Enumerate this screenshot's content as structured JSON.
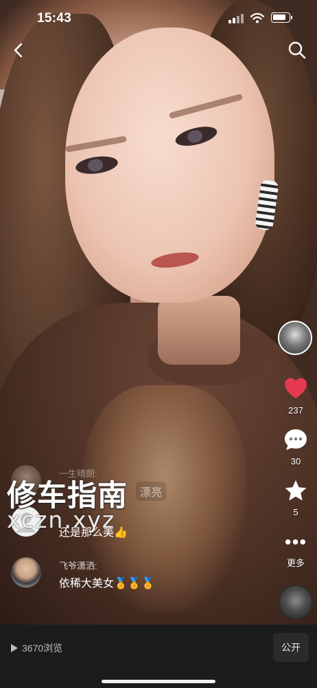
{
  "status_bar": {
    "time": "15:43"
  },
  "icons": {
    "back": "chevron-left-icon",
    "search": "search-icon",
    "like": "heart-icon",
    "comment": "chat-bubble-icon",
    "favorite": "star-icon",
    "more": "ellipsis-icon"
  },
  "colors": {
    "like": "#e53950",
    "background": "#1c1c1c"
  },
  "actions": {
    "likes": "237",
    "comments": "30",
    "stars": "5",
    "more_label": "更多"
  },
  "comments": [
    {
      "name": "一生晴朗:",
      "text": "漂亮"
    },
    {
      "name": "",
      "text": "还是那么美👍"
    },
    {
      "name": "飞爷潇洒:",
      "text": "依稀大美女🏅🏅🏅"
    }
  ],
  "watermark": {
    "main": "修车指南",
    "sub": "xczn.xyz"
  },
  "footer": {
    "views": "3670浏览",
    "visibility": "公开"
  }
}
